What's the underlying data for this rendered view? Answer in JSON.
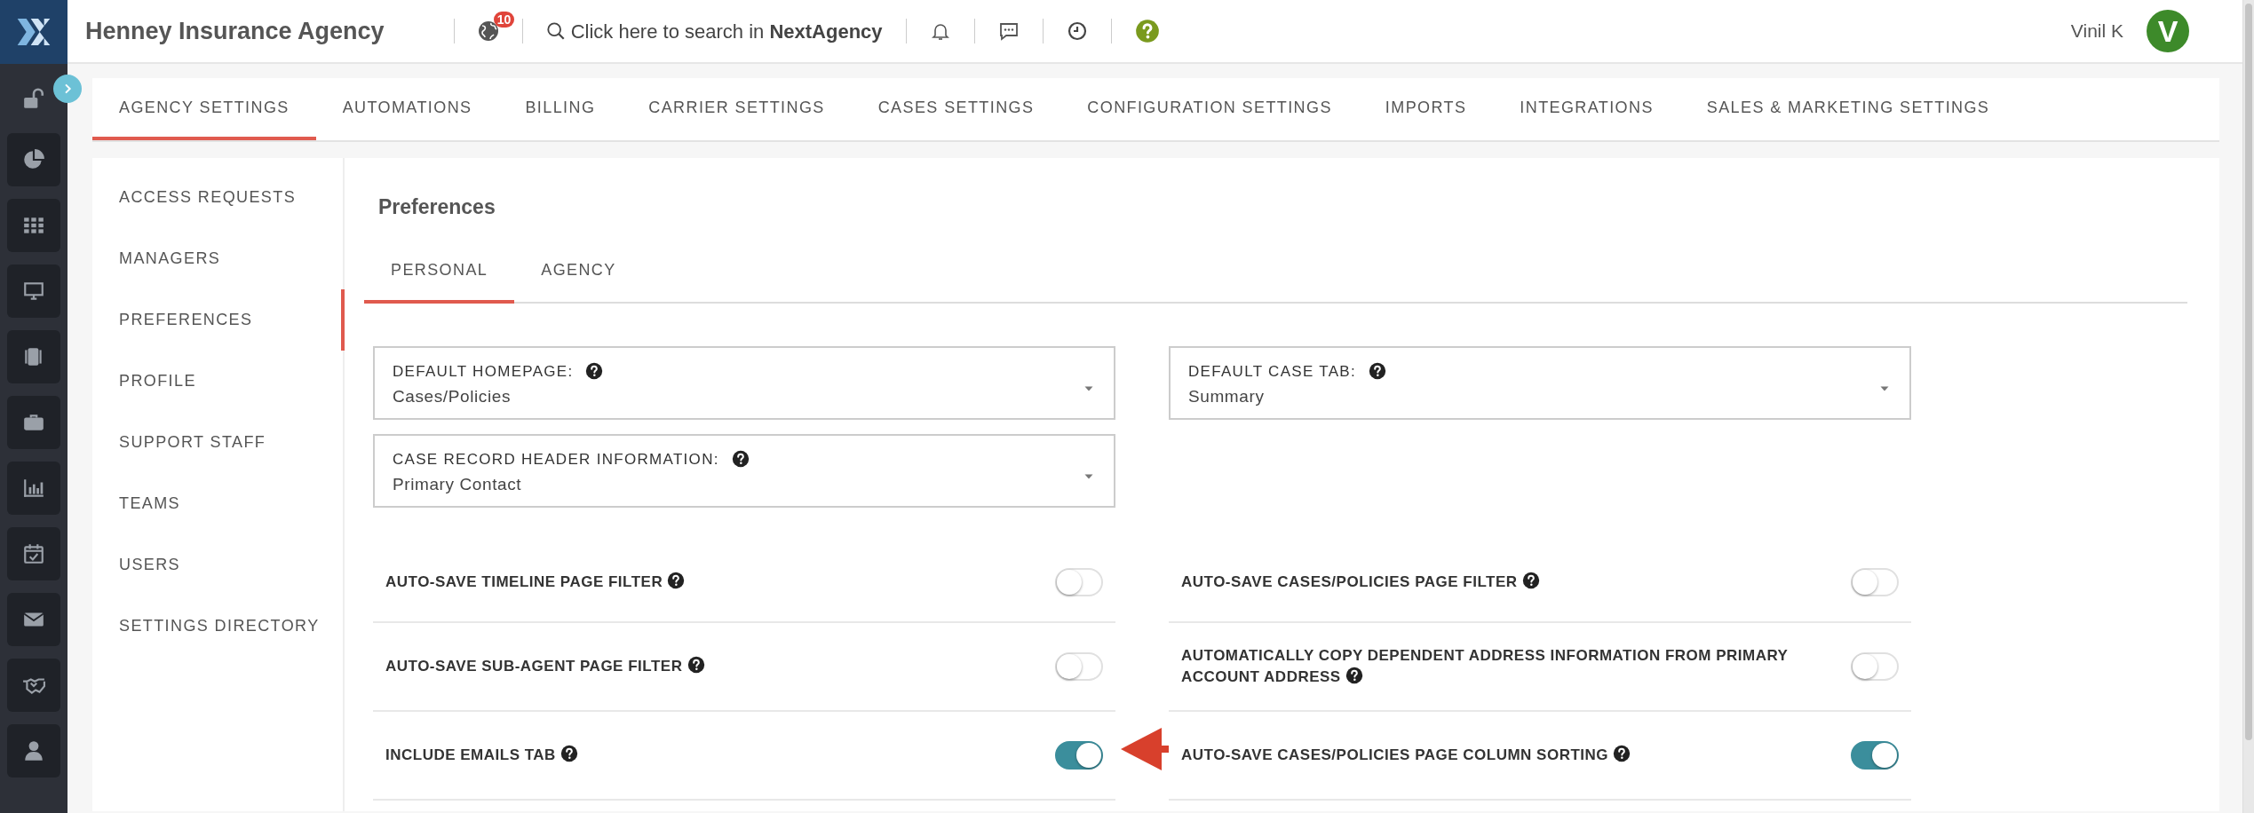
{
  "header": {
    "title": "Henney Insurance Agency",
    "notification_count": "10",
    "search_text": "Click here to search in **NextAgency**",
    "user_name": "Vinil K",
    "user_initial": "V"
  },
  "top_tabs": [
    {
      "label": "AGENCY SETTINGS",
      "selected": true
    },
    {
      "label": "AUTOMATIONS",
      "selected": false
    },
    {
      "label": "BILLING",
      "selected": false
    },
    {
      "label": "CARRIER SETTINGS",
      "selected": false
    },
    {
      "label": "CASES SETTINGS",
      "selected": false
    },
    {
      "label": "CONFIGURATION SETTINGS",
      "selected": false
    },
    {
      "label": "IMPORTS",
      "selected": false
    },
    {
      "label": "INTEGRATIONS",
      "selected": false
    },
    {
      "label": "SALES & MARKETING SETTINGS",
      "selected": false
    }
  ],
  "settings_menu": [
    {
      "label": "ACCESS REQUESTS",
      "selected": false
    },
    {
      "label": "MANAGERS",
      "selected": false
    },
    {
      "label": "PREFERENCES",
      "selected": true
    },
    {
      "label": "PROFILE",
      "selected": false
    },
    {
      "label": "SUPPORT STAFF",
      "selected": false
    },
    {
      "label": "TEAMS",
      "selected": false
    },
    {
      "label": "USERS",
      "selected": false
    },
    {
      "label": "SETTINGS DIRECTORY",
      "selected": false
    }
  ],
  "section": {
    "title": "Preferences",
    "tabs": [
      {
        "label": "PERSONAL",
        "selected": true
      },
      {
        "label": "AGENCY",
        "selected": false
      }
    ],
    "columns": [
      {
        "selects": [
          {
            "label": "DEFAULT HOMEPAGE:",
            "value": "Cases/Policies"
          },
          {
            "label": "CASE RECORD HEADER INFORMATION:",
            "value": "Primary Contact"
          }
        ],
        "toggles": [
          {
            "label": "AUTO-SAVE TIMELINE PAGE FILTER",
            "on": false
          },
          {
            "label": "AUTO-SAVE SUB-AGENT PAGE FILTER",
            "on": false
          },
          {
            "label": "INCLUDE EMAILS TAB",
            "on": true
          }
        ]
      },
      {
        "selects": [
          {
            "label": "DEFAULT CASE TAB:",
            "value": "Summary"
          }
        ],
        "toggles": [
          {
            "label": "AUTO-SAVE CASES/POLICIES PAGE FILTER",
            "on": false
          },
          {
            "label": "AUTOMATICALLY COPY DEPENDENT ADDRESS INFORMATION FROM PRIMARY ACCOUNT ADDRESS",
            "on": false
          },
          {
            "label": "AUTO-SAVE CASES/POLICIES PAGE COLUMN SORTING",
            "on": true
          }
        ]
      }
    ]
  }
}
